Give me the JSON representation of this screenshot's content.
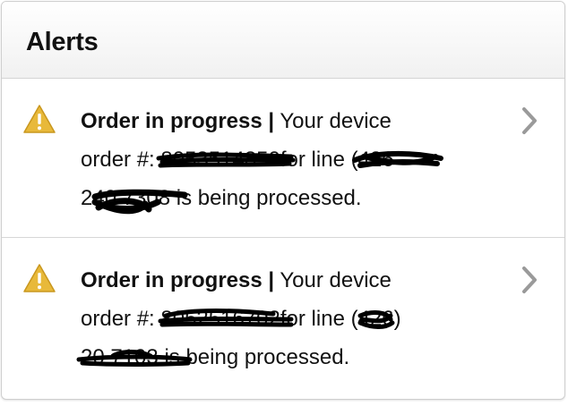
{
  "header": {
    "title": "Alerts"
  },
  "alerts": [
    {
      "title": "Order in progress |",
      "text_a": "Your device",
      "text_b": "order #:",
      "order_num": "8053514850",
      "text_c": "for line (",
      "line_area": "426",
      "line_rest": "240 7308",
      "text_d": "is being processed."
    },
    {
      "title": "Order in progress |",
      "text_a": "Your device",
      "text_b": "order #:",
      "order_num": "8052516702",
      "text_c": "for line (",
      "line_area": "426",
      "line_rest": "20 7103",
      "text_d": "is being processed.",
      "area_suffix": ")"
    }
  ],
  "colors": {
    "warning_fill": "#e8b93a",
    "chevron": "#9a9a9a",
    "redaction": "#000000"
  },
  "icons": {
    "warning": "warning-triangle-icon",
    "chevron": "chevron-right-icon"
  }
}
